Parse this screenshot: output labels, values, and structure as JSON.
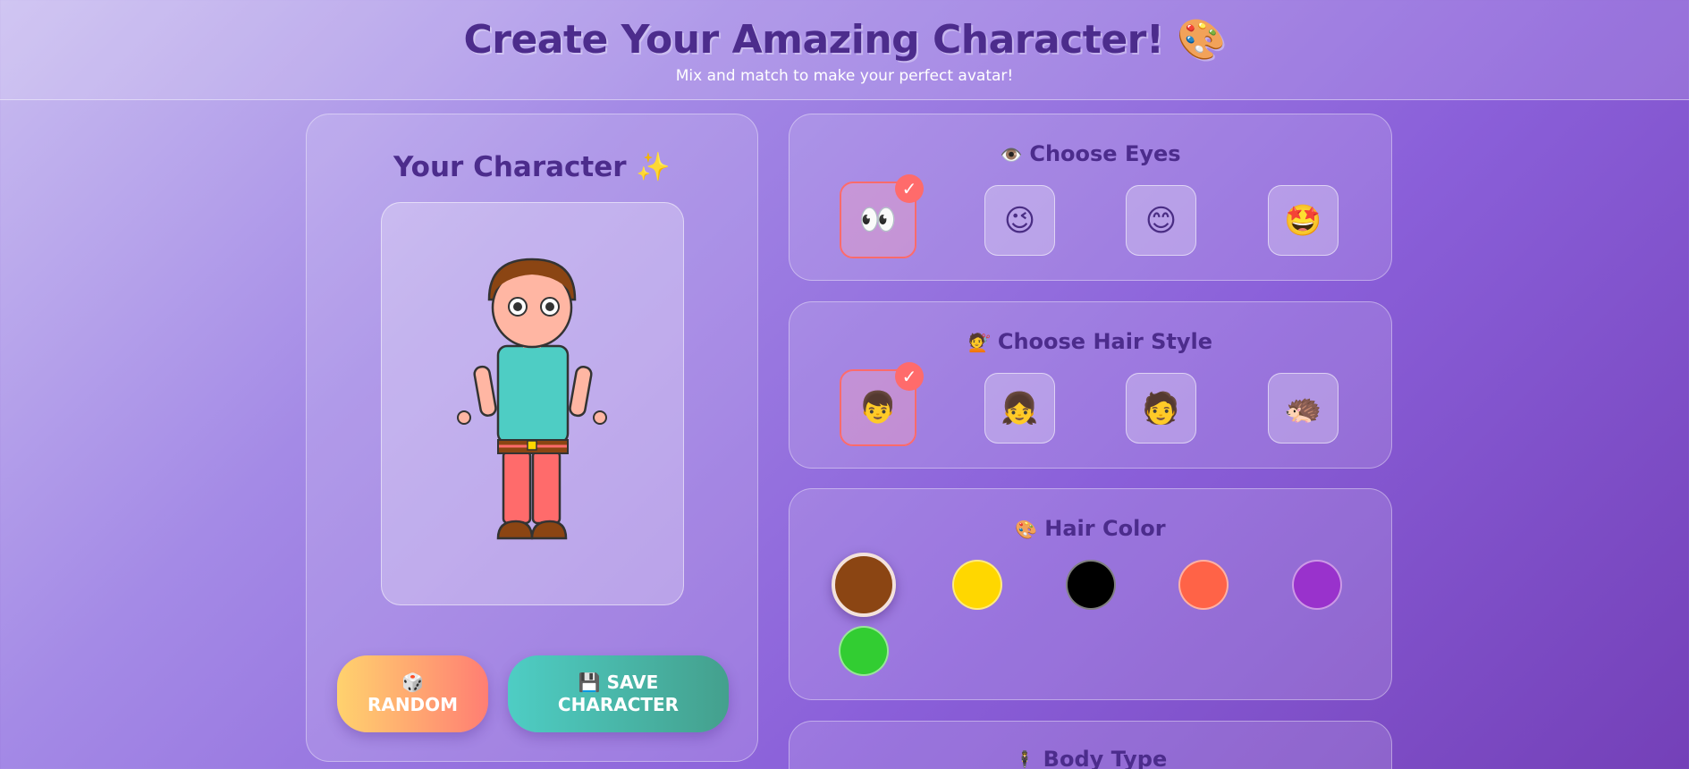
{
  "header": {
    "title": "Create Your Amazing Character! 🎨",
    "subtitle": "Mix and match to make your perfect avatar!"
  },
  "preview": {
    "title": "Your Character ✨",
    "random_icon": "🎲",
    "random_label": "RANDOM",
    "save_icon": "💾",
    "save_label": "SAVE CHARACTER"
  },
  "eyes": {
    "icon": "👁️",
    "title": "Choose Eyes",
    "options": [
      "👀",
      "😉",
      "😊",
      "🤩"
    ],
    "selected": 0,
    "check": "✓"
  },
  "hair_style": {
    "icon": "💇",
    "title": "Choose Hair Style",
    "options": [
      "👦",
      "👧",
      "🧑",
      "🦔"
    ],
    "selected": 0,
    "check": "✓"
  },
  "hair_color": {
    "icon": "🎨",
    "title": "Hair Color",
    "swatches": [
      "#8B4513",
      "#FFD700",
      "#000000",
      "#FF6347",
      "#9932CC",
      "#32CD32"
    ],
    "selected": 0
  },
  "body_type": {
    "icon": "🕴️",
    "title": "Body Type"
  },
  "colors": {
    "skin": "#FFB6A3",
    "shirt": "#4ECDC4",
    "pants": "#FF6B6B",
    "belt": "#8B4513",
    "buckle": "#FFD700",
    "shoes": "#8B4513",
    "outline": "#333333"
  }
}
